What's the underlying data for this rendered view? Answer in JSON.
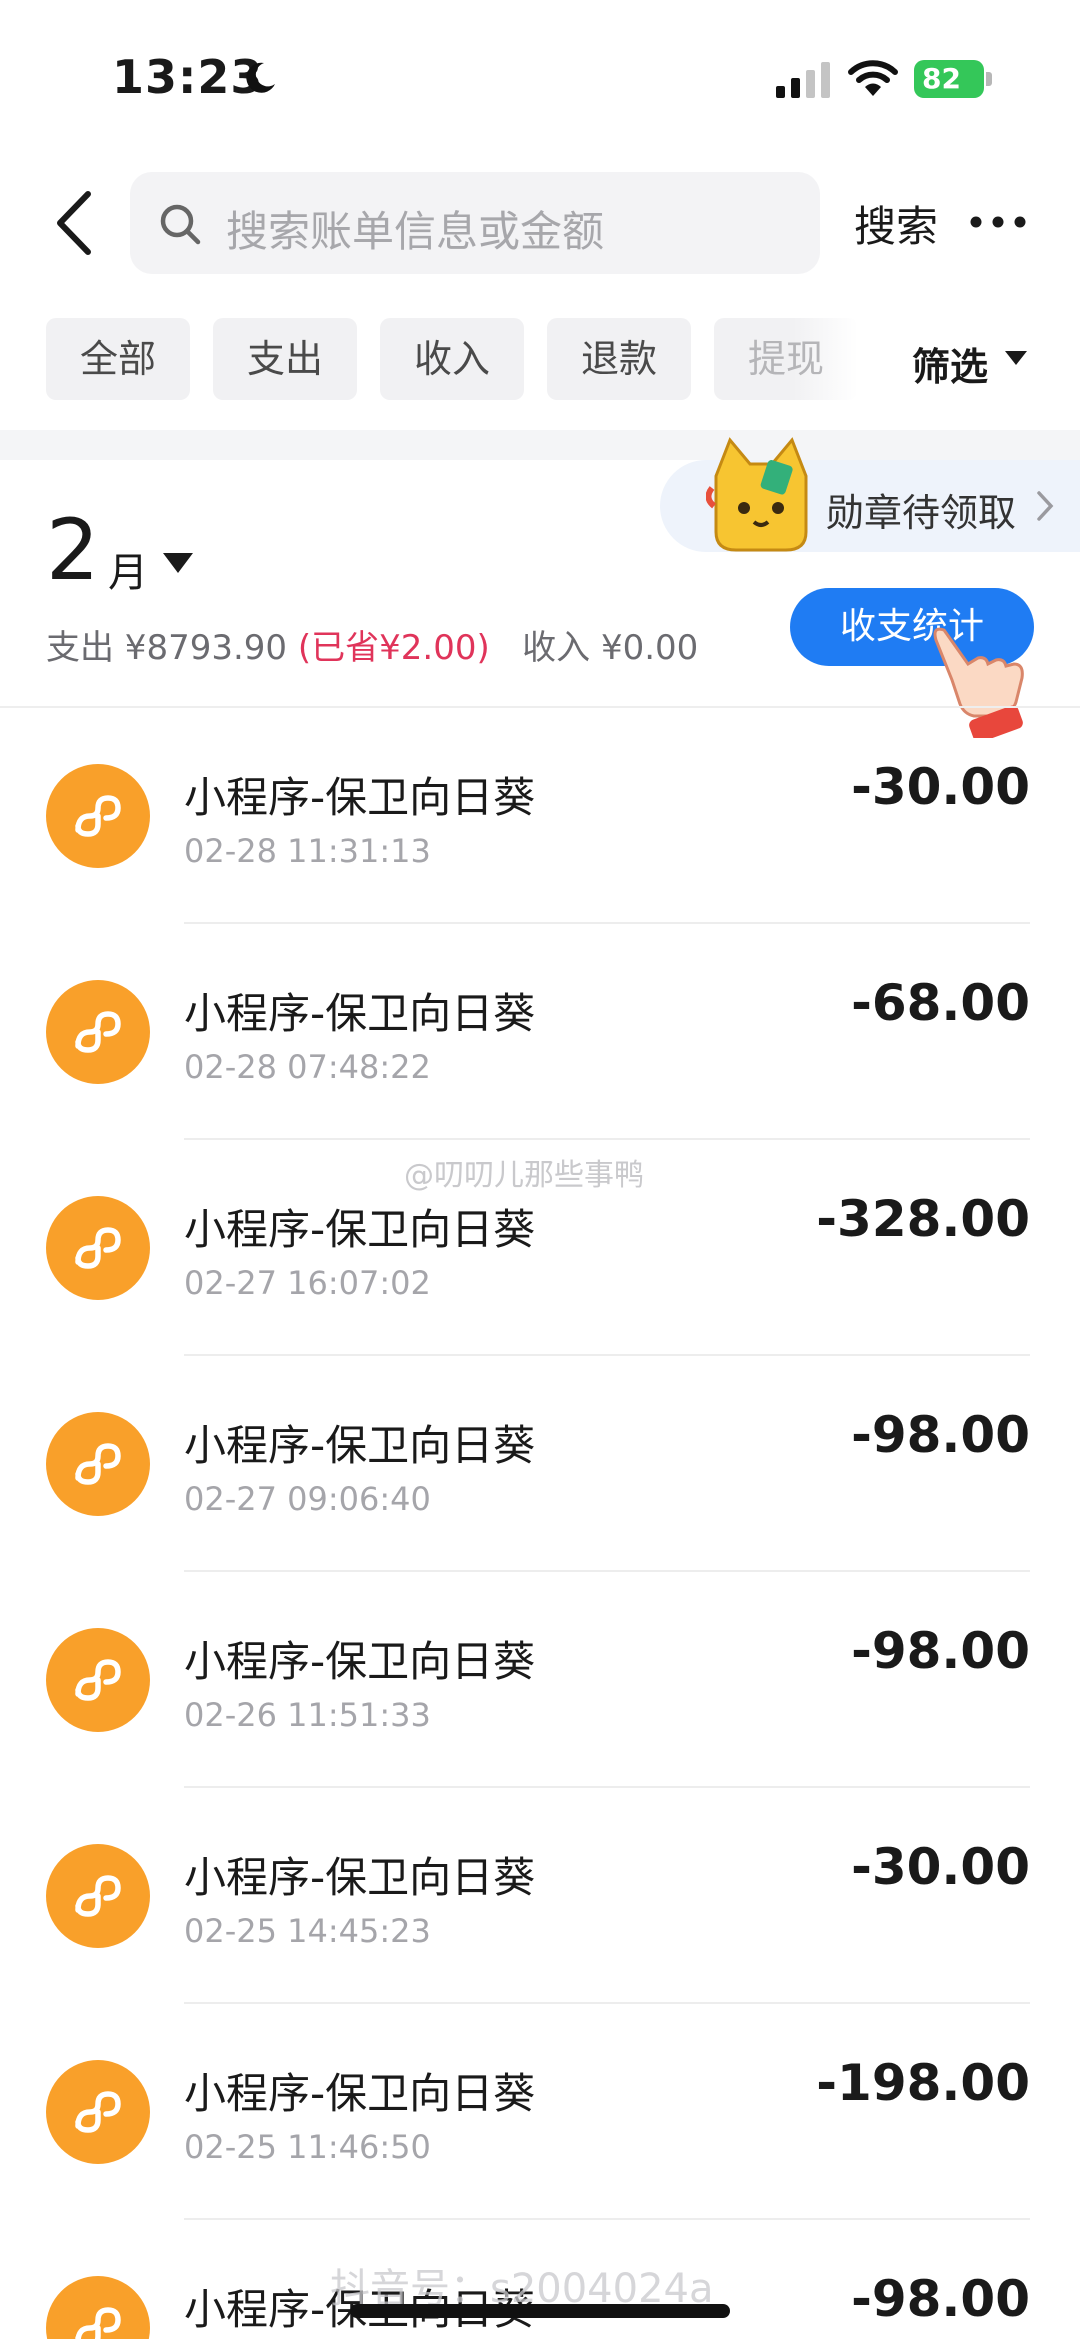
{
  "status_bar": {
    "time": "13:23",
    "battery": "82"
  },
  "header": {
    "search_placeholder": "搜索账单信息或金额",
    "search_button": "搜索"
  },
  "filter_tabs": [
    "全部",
    "支出",
    "收入",
    "退款",
    "提现"
  ],
  "filter_button": "筛选",
  "badge_banner": {
    "text": "勋章待领取"
  },
  "summary": {
    "month_number": "2",
    "month_unit": "月",
    "expense": "支出 ¥8793.90",
    "saved": "(已省¥2.00)",
    "income": "收入 ¥0.00",
    "stats_button": "收支统计"
  },
  "transactions": [
    {
      "title": "小程序-保卫向日葵",
      "time": "02-28 11:31:13",
      "amount": "-30.00"
    },
    {
      "title": "小程序-保卫向日葵",
      "time": "02-28 07:48:22",
      "amount": "-68.00"
    },
    {
      "title": "小程序-保卫向日葵",
      "time": "02-27 16:07:02",
      "amount": "-328.00"
    },
    {
      "title": "小程序-保卫向日葵",
      "time": "02-27 09:06:40",
      "amount": "-98.00"
    },
    {
      "title": "小程序-保卫向日葵",
      "time": "02-26 11:51:33",
      "amount": "-98.00"
    },
    {
      "title": "小程序-保卫向日葵",
      "time": "02-25 14:45:23",
      "amount": "-30.00"
    },
    {
      "title": "小程序-保卫向日葵",
      "time": "02-25 11:46:50",
      "amount": "-198.00"
    },
    {
      "title": "小程序-保卫向日葵",
      "time": "",
      "amount": "-98.00"
    }
  ],
  "watermarks": {
    "center": "@叨叨儿那些事鸭",
    "bottom": "抖音号：s2004024a"
  },
  "colors": {
    "accent": "#1f7cf3",
    "saved": "#e0345a",
    "miniprogram_icon": "#f9a02a",
    "battery": "#34c759"
  }
}
